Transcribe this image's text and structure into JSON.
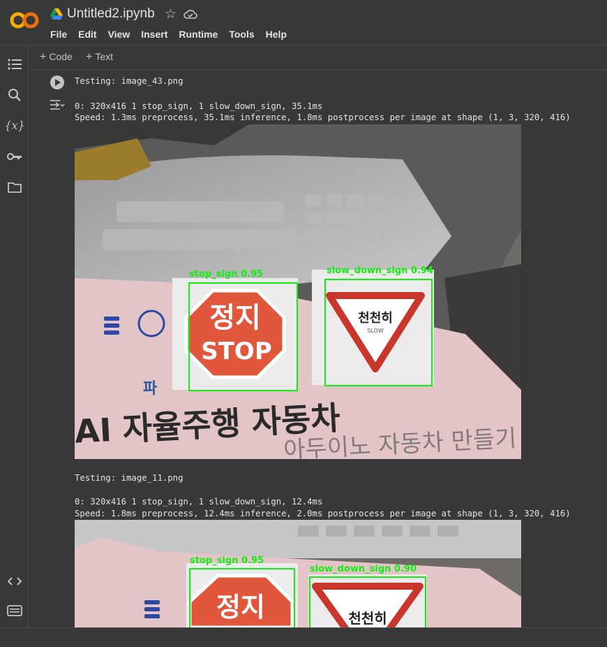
{
  "app": {
    "logo_text": "CO",
    "file_name": "Untitled2.ipynb",
    "star_icon": "star-icon",
    "cloud_icon": "cloud-sync-icon"
  },
  "menu": [
    "File",
    "Edit",
    "View",
    "Insert",
    "Runtime",
    "Tools",
    "Help"
  ],
  "sidebar": [
    "table-of-contents-icon",
    "search-icon",
    "variables-icon",
    "secrets-key-icon",
    "folder-icon",
    "code-snippets-icon",
    "terminal-icon"
  ],
  "toolbar": {
    "code_label": "Code",
    "text_label": "Text"
  },
  "output": {
    "block1": {
      "testing": "Testing: image_43.png",
      "result": "0: 320x416 1 stop_sign, 1 slow_down_sign, 35.1ms",
      "speed": "Speed: 1.3ms preprocess, 35.1ms inference, 1.8ms postprocess per image at shape (1, 3, 320, 416)",
      "det1": "stop_sign  0.95",
      "det2": "slow_down_sign  0.94",
      "sign_stop_ko": "정지",
      "sign_stop_en": "STOP",
      "sign_slow_ko": "천천히",
      "sign_slow_en": "SLOW",
      "book_title": "AI 자율주행 자동차",
      "book_subtitle": "아두이노 자동차 만들기",
      "book_prefix": "파"
    },
    "block2": {
      "testing": "Testing: image_11.png",
      "result": "0: 320x416 1 stop_sign, 1 slow_down_sign, 12.4ms",
      "speed": "Speed: 1.8ms preprocess, 12.4ms inference, 2.0ms postprocess per image at shape (1, 3, 320, 416)",
      "det1": "stop_sign  0.95",
      "det2": "slow_down_sign  0.90",
      "sign_stop_ko": "정지",
      "sign_slow_ko": "천천히"
    }
  },
  "colors": {
    "background": "#383838",
    "detection_box": "#11ee11",
    "stop_sign_red": "#e0573c",
    "logo_orange": "#f9ab00"
  }
}
